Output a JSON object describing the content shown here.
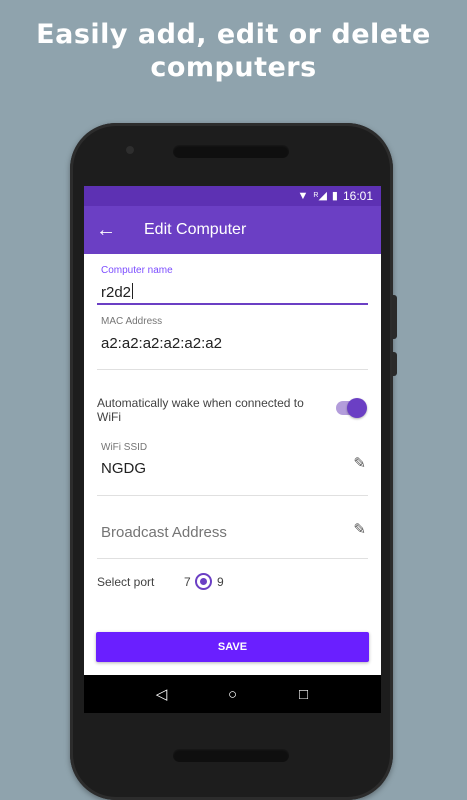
{
  "headline": {
    "line1": "Easily add, edit or delete",
    "line2": "computers"
  },
  "statusbar": {
    "wifi_icon": "wifi-icon",
    "roaming": "R",
    "signal_icon": "signal-icon",
    "battery_icon": "battery-icon",
    "time": "16:01"
  },
  "toolbar": {
    "back_icon": "←",
    "title": "Edit Computer"
  },
  "form": {
    "computer_name": {
      "label": "Computer name",
      "value": "r2d2"
    },
    "mac_address": {
      "label": "MAC Address",
      "value": "a2:a2:a2:a2:a2:a2"
    },
    "auto_wake": {
      "label": "Automatically wake when connected to WiFi",
      "enabled": true
    },
    "wifi_ssid": {
      "label": "WiFi SSID",
      "value": "NGDG"
    },
    "broadcast_address": {
      "placeholder": "Broadcast Address"
    },
    "port": {
      "label": "Select port",
      "options": [
        "7",
        "9"
      ],
      "selected": "9"
    }
  },
  "save_label": "SAVE",
  "navbar": {
    "back": "◁",
    "home": "○",
    "recents": "□"
  },
  "colors": {
    "accent": "#6b3fc4",
    "status_bar": "#5d31b3",
    "save_button": "#6a1fff",
    "background": "#8fa3ad"
  }
}
